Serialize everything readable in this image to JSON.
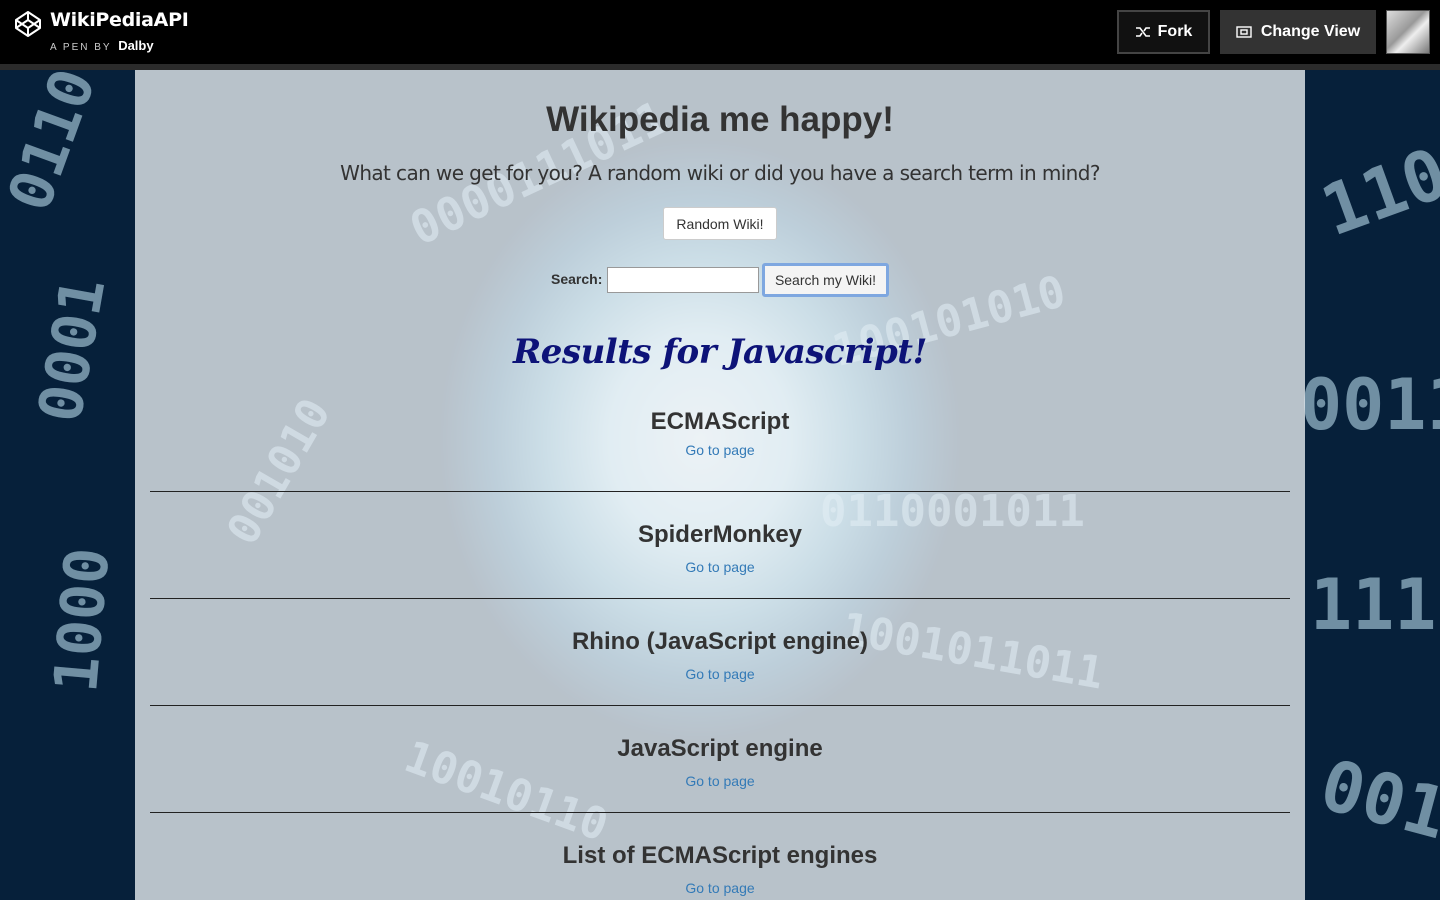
{
  "codepen_bar": {
    "pen_title": "WikiPediaAPI",
    "pen_by": "A PEN BY",
    "author": "Dalby",
    "fork_label": "Fork",
    "change_view_label": "Change View"
  },
  "page": {
    "heading": "Wikipedia me happy!",
    "subtitle": "What can we get for you? A random wiki or did you have a search term in mind?",
    "random_button": "Random Wiki!",
    "search_label": "Search:",
    "search_value": "",
    "search_button": "Search my Wiki!",
    "results_heading": "Results for Javascript!"
  },
  "results": [
    {
      "title": "ECMAScript",
      "link": "Go to page"
    },
    {
      "title": "SpiderMonkey",
      "link": "Go to page"
    },
    {
      "title": "Rhino (JavaScript engine)",
      "link": "Go to page"
    },
    {
      "title": "JavaScript engine",
      "link": "Go to page"
    },
    {
      "title": "List of ECMAScript engines",
      "link": "Go to page"
    }
  ],
  "colors": {
    "results_heading": "#0d1378",
    "link": "#337ab7",
    "topbar": "#000000"
  }
}
